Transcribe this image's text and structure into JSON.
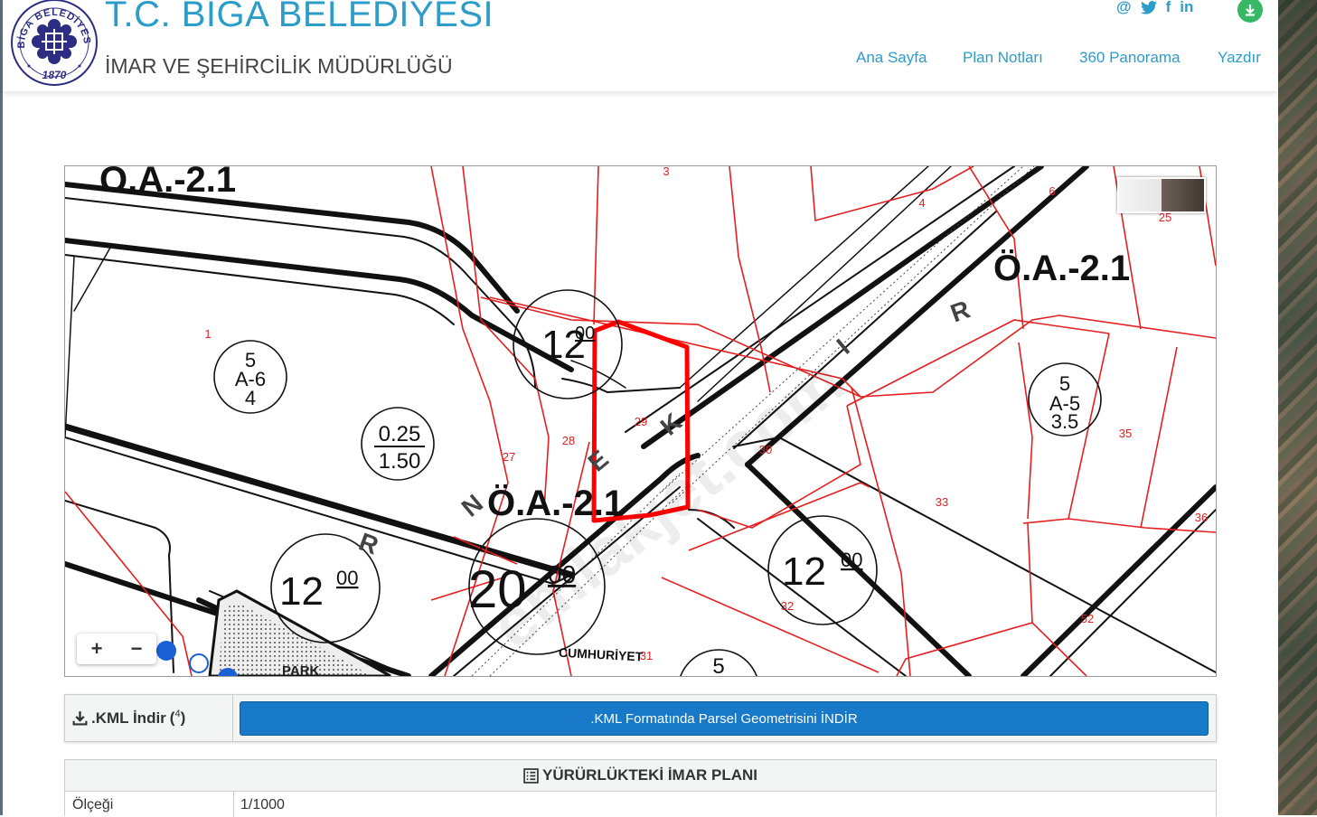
{
  "header": {
    "title": "T.C. BIGA BELEDIYESI",
    "subtitle": "İMAR VE ŞEHİRCİLİK MÜDÜRLÜĞÜ",
    "logo": {
      "top_text": "BİGA BELEDİYESİ",
      "year": "1870"
    },
    "social_icons": [
      "at-icon",
      "twitter-icon",
      "facebook-icon",
      "linkedin-icon"
    ],
    "social_glyphs": {
      "at": "@",
      "facebook": "f",
      "linkedin": "in"
    },
    "nav": [
      {
        "label": "Ana Sayfa"
      },
      {
        "label": "Plan Notları"
      },
      {
        "label": "360 Panorama"
      },
      {
        "label": "Yazdır"
      }
    ],
    "accent_color": "#2b9dc8",
    "download_color": "#37b865"
  },
  "map": {
    "zones": [
      "Ö.A.-2.1",
      "Ö.A.-2.1",
      "Ö.A.-2.1"
    ],
    "road_widths": [
      "12",
      "12",
      "12",
      "20",
      "12"
    ],
    "road_width_sup": "00",
    "fractions": [
      {
        "top": "5",
        "mid": "A-6",
        "bottom": "4"
      },
      {
        "top": "0.25",
        "bottom": "1.50"
      },
      {
        "top": "5",
        "mid": "A-5",
        "bottom": "3.5"
      }
    ],
    "circle_partial": "5",
    "parcels": [
      "1",
      "3",
      "4",
      "6",
      "25",
      "27",
      "28",
      "29",
      "30",
      "31",
      "32",
      "33",
      "35",
      "36",
      "52"
    ],
    "road_letters": [
      "R",
      "R",
      "K",
      "E",
      "N",
      "I"
    ],
    "labels": {
      "park": "PARK",
      "street": "CUMHURİYET"
    },
    "watermark": "emlakjet.com",
    "zoom_in": "+",
    "zoom_out": "−",
    "parcel_color": "#e41f1f",
    "selected_parcel_color": "#ff0000"
  },
  "kml": {
    "label": ".KML İndir",
    "count_open": "(",
    "count": "4",
    "count_close": ")",
    "button": ".KML Formatında Parsel Geometrisini İNDİR",
    "button_color": "#1779c8"
  },
  "plan": {
    "heading": "YÜRÜRLÜKTEKİ İMAR PLANI",
    "rows": [
      {
        "key": "Ölçeği",
        "value": "1/1000"
      }
    ]
  }
}
